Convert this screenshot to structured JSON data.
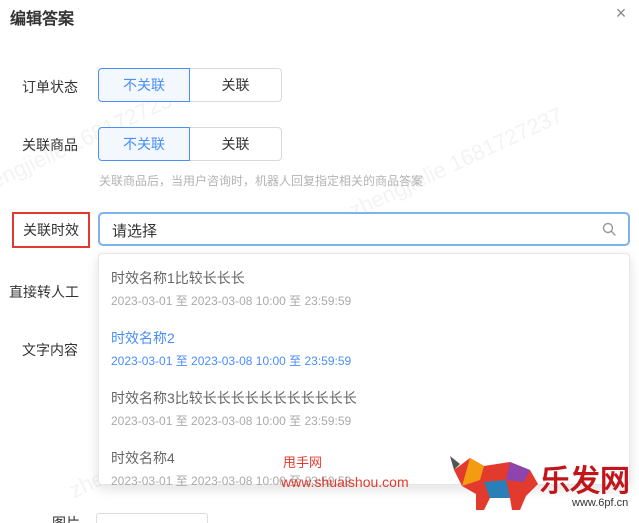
{
  "dialog": {
    "title": "编辑答案",
    "close_glyph": "×"
  },
  "order_status": {
    "label": "订单状态",
    "options": [
      "不关联",
      "关联"
    ],
    "selected": "不关联"
  },
  "related_product": {
    "label": "关联商品",
    "options": [
      "不关联",
      "关联"
    ],
    "selected": "不关联",
    "hint": "关联商品后，当用户咨询时，机器人回复指定相关的商品答案"
  },
  "related_timing": {
    "label": "关联时效",
    "placeholder": "请选择",
    "options": [
      {
        "name": "时效名称1比较长长长",
        "time": "2023-03-01 至 2023-03-08  10:00 至 23:59:59",
        "selected": false
      },
      {
        "name": "时效名称2",
        "time": "2023-03-01 至 2023-03-08  10:00 至 23:59:59",
        "selected": true
      },
      {
        "name": "时效名称3比较长长长长长长长长长长长",
        "time": "2023-03-01 至 2023-03-08  10:00 至 23:59:59",
        "selected": false
      },
      {
        "name": "时效名称4",
        "time": "2023-03-01 至 2023-03-08  10:00 至 23:59:59",
        "selected": false
      }
    ]
  },
  "transfer_label": "直接转人工",
  "text_content_label": "文字内容",
  "image_label": "图片",
  "watermark_text": "zhengjielie 1681727237",
  "branding": {
    "site_cn": "甩手网",
    "site_url": "www.shuaishou.com",
    "logo_text": "乐发网",
    "logo_url": "www.6pf.cn"
  },
  "colors": {
    "accent": "#4a8ef7",
    "highlight_border": "#e23a2d"
  }
}
